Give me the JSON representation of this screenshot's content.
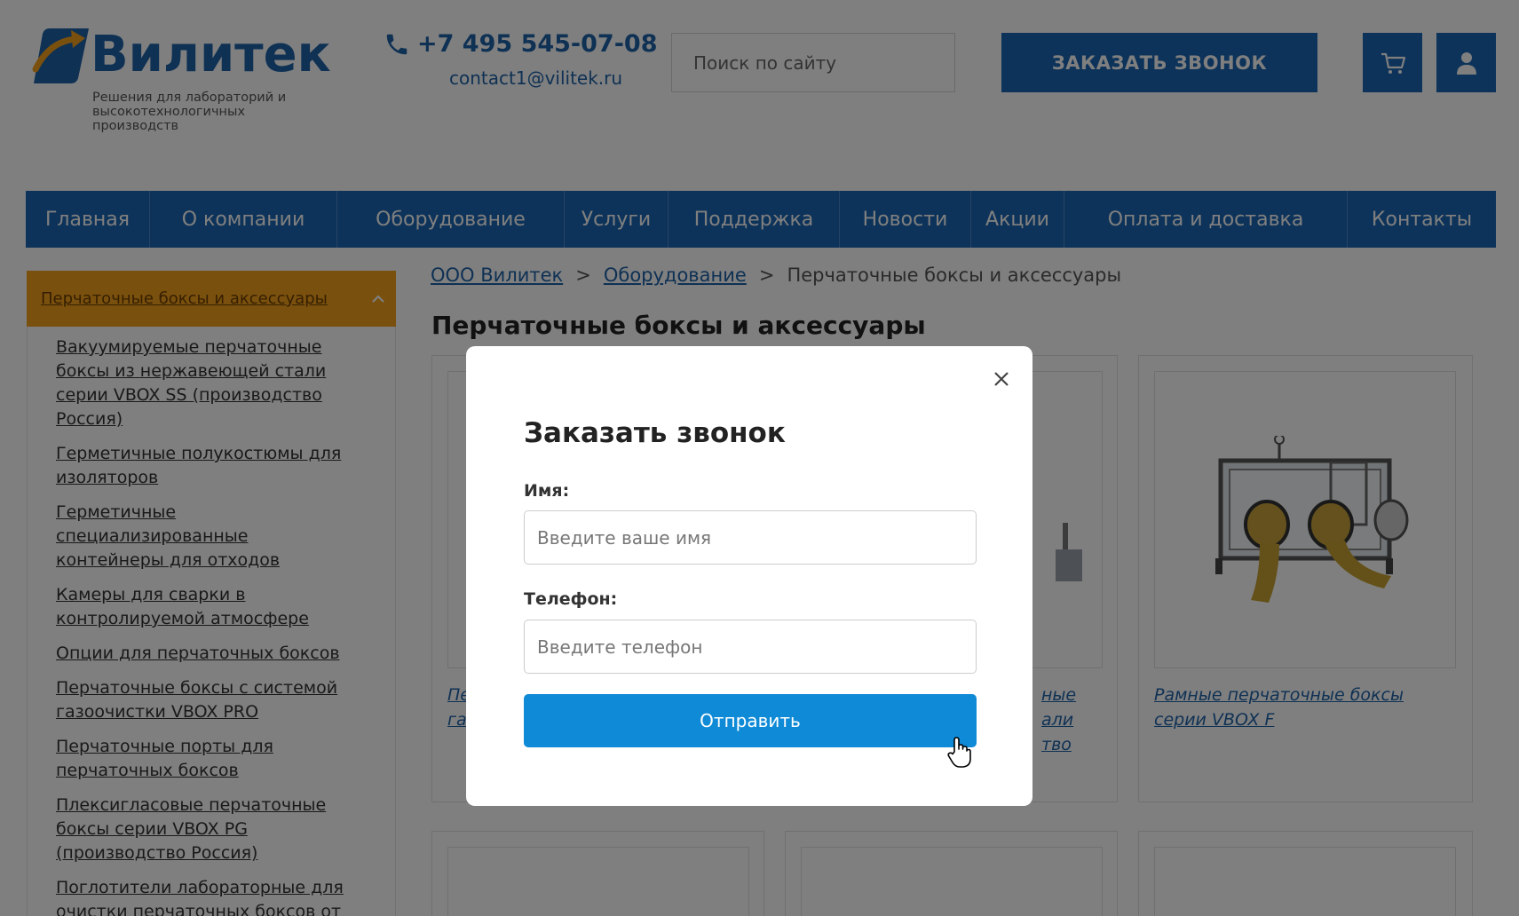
{
  "colors": {
    "brand_blue": "#1a66b4",
    "accent_orange": "#f4a11c",
    "submit_blue": "#0f8ad6",
    "overlay": "rgba(0,0,0,0.5)"
  },
  "header": {
    "logo_text": "Вилитек",
    "logo_icon": "vilitek-logo-mark",
    "tagline": "Решения для лабораторий и высокотехнологичных производств",
    "phone": "+7 495 545-07-08",
    "phone_icon": "phone-icon",
    "email": "contact1@vilitek.ru",
    "search_placeholder": "Поиск по сайту",
    "call_button": "ЗАКАЗАТЬ ЗВОНОК",
    "cart_icon": "cart-icon",
    "user_icon": "user-icon"
  },
  "nav": {
    "items": [
      {
        "label": "Главная"
      },
      {
        "label": "О компании"
      },
      {
        "label": "Оборудование"
      },
      {
        "label": "Услуги"
      },
      {
        "label": "Поддержка"
      },
      {
        "label": "Новости"
      },
      {
        "label": "Акции"
      },
      {
        "label": "Оплата и доставка"
      },
      {
        "label": "Контакты"
      }
    ]
  },
  "sidebar": {
    "active": "Перчаточные боксы и аксессуары",
    "items": [
      {
        "label": "Вакуумируемые перчаточные боксы из нержавеющей стали серии VBOX SS (производство Россия)"
      },
      {
        "label": "Герметичные полукостюмы для изоляторов"
      },
      {
        "label": "Герметичные специализированные контейнеры для отходов"
      },
      {
        "label": "Камеры для сварки в контролируемой атмосфере"
      },
      {
        "label": "Опции для перчаточных боксов"
      },
      {
        "label": "Перчаточные боксы с системой газоочистки VBOX PRO"
      },
      {
        "label": "Перчаточные порты для перчаточных боксов"
      },
      {
        "label": "Плексигласовые перчаточные боксы серии VBOX PG (производство Россия)"
      },
      {
        "label": "Поглотители лабораторные для очистки перчаточных боксов от"
      }
    ]
  },
  "breadcrumb": {
    "items": [
      "ООО Вилитек",
      "Оборудование",
      "Перчаточные боксы и аксессуары"
    ],
    "separator": ">"
  },
  "page_title": "Перчаточные боксы и аксессуары",
  "cards": {
    "c1_caption": "Пе\nга",
    "c2_caption": "ные\nали\nтво",
    "c3_caption": "Рамные перчаточные боксы серии VBOX F"
  },
  "modal": {
    "title": "Заказать звонок",
    "name_label": "Имя:",
    "name_placeholder": "Введите ваше имя",
    "phone_label": "Телефон:",
    "phone_placeholder": "Введите телефон",
    "submit": "Отправить",
    "close_icon": "close-icon"
  }
}
